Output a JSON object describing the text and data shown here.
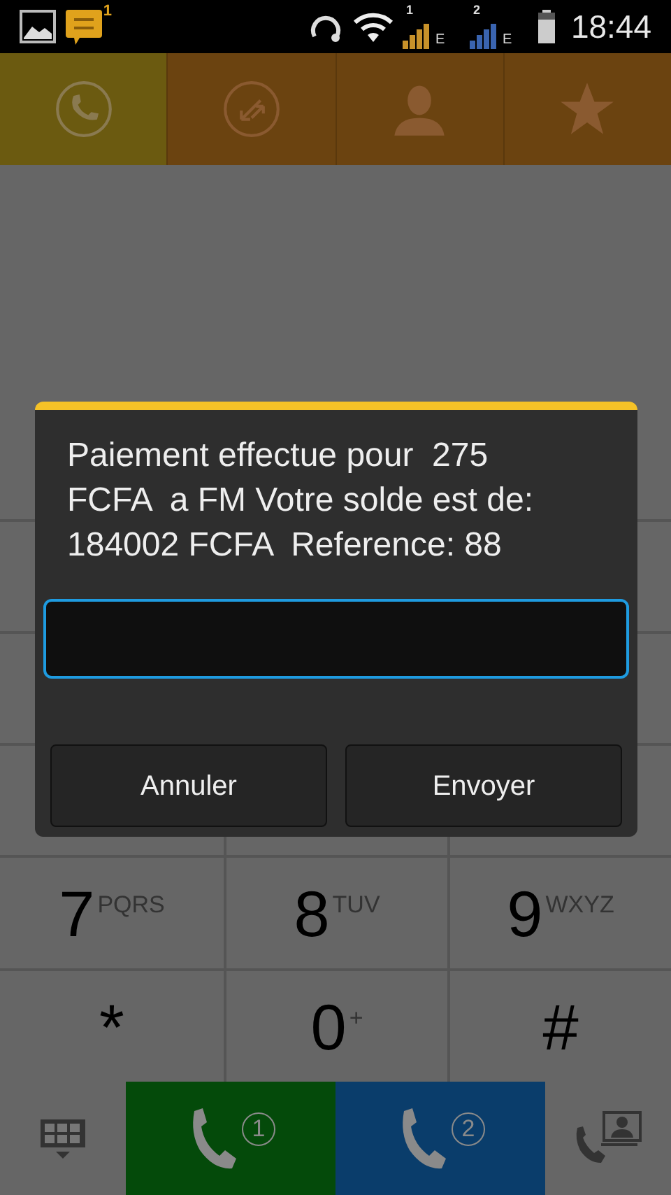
{
  "status_bar": {
    "notification_count": "1",
    "sims": [
      {
        "label": "1",
        "network": "E",
        "color": "#c8922a"
      },
      {
        "label": "2",
        "network": "E",
        "color": "#3a64b0"
      }
    ],
    "time": "18:44"
  },
  "tabs": [
    {
      "kind": "call",
      "selected": true
    },
    {
      "kind": "recent",
      "selected": false
    },
    {
      "kind": "contact",
      "selected": false
    },
    {
      "kind": "favorite",
      "selected": false
    }
  ],
  "dialog": {
    "message": "Paiement effectue pour  275 FCFA  a FM Votre solde est de: 184002 FCFA  Reference: 88",
    "buttons": [
      "Annuler",
      "Envoyer"
    ]
  },
  "keypad": [
    {
      "digit": "7",
      "letters": "PQRS"
    },
    {
      "digit": "8",
      "letters": "TUV"
    },
    {
      "digit": "9",
      "letters": "WXYZ"
    },
    {
      "digit": "*"
    },
    {
      "digit": "0",
      "letters": "+"
    },
    {
      "digit": "#"
    }
  ],
  "call_buttons": [
    {
      "label": "1",
      "color": "#044a0a"
    },
    {
      "label": "2",
      "color": "#0a3d6b"
    }
  ]
}
